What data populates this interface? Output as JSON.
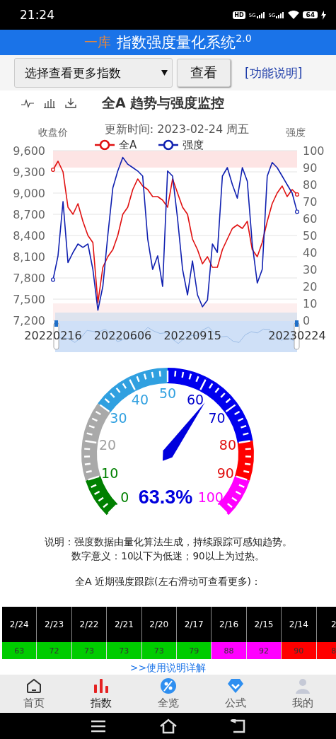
{
  "status_bar": {
    "time": "21:24",
    "hd_label": "HD",
    "networks": [
      "5G",
      "5G"
    ],
    "battery": "64"
  },
  "header": {
    "logo_text": "一库",
    "title": "指数强度量化系统$^{2.0}$"
  },
  "controls": {
    "select": "选择查看更多指数",
    "view_button": "查看",
    "help_link": "[功能说明]"
  },
  "chart_panel": {
    "title": "全A 趋势与强度监控",
    "chart_data": {
      "type": "line",
      "title": "更新时间: 2023-02-24 周五",
      "ylabel": "收盘价",
      "y2label": "强度",
      "categories": [
        "20220216",
        null,
        null,
        null,
        null,
        null,
        null,
        null,
        null,
        null,
        null,
        null,
        null,
        null,
        "20220606",
        null,
        null,
        null,
        null,
        null,
        null,
        null,
        null,
        null,
        null,
        null,
        null,
        null,
        "20220915",
        null,
        null,
        null,
        null,
        null,
        null,
        null,
        null,
        null,
        null,
        null,
        null,
        null,
        null,
        null,
        null,
        null,
        null,
        null,
        null,
        "20230224"
      ],
      "grid": true,
      "legend": "top",
      "ylim": [
        7200,
        9600
      ],
      "yticks": [
        {
          "value": 7200,
          "label": "7,200"
        },
        {
          "value": 7500,
          "label": "7,500"
        },
        {
          "value": 7800,
          "label": "7,800"
        },
        {
          "value": 8100,
          "label": "8,100"
        },
        {
          "value": 8400,
          "label": "8,400"
        },
        {
          "value": 8700,
          "label": "8,700"
        },
        {
          "value": 9000,
          "label": "9,000"
        },
        {
          "value": 9300,
          "label": "9,300"
        },
        {
          "value": 9600,
          "label": "9,600"
        }
      ],
      "y2lim": [
        0,
        100
      ],
      "y2ticks": [
        0,
        10,
        20,
        30,
        40,
        50,
        60,
        70,
        80,
        90,
        100
      ],
      "series": [
        {
          "name": "全A",
          "color": "#e01010",
          "values": [
            9330,
            9450,
            9300,
            8800,
            8700,
            8850,
            8600,
            8400,
            8300,
            7450,
            7950,
            8100,
            8200,
            8400,
            8700,
            8800,
            9050,
            9200,
            9100,
            9050,
            8950,
            8950,
            8900,
            8800,
            9200,
            9000,
            8800,
            8700,
            8350,
            8200,
            8000,
            8100,
            7950,
            7950,
            8200,
            8350,
            8500,
            8550,
            8500,
            8600,
            8200,
            8100,
            8300,
            8600,
            8850,
            9000,
            9100,
            8950,
            9050,
            8980
          ]
        },
        {
          "name": "强度",
          "color": "#1020b0",
          "axis": "y2",
          "values": [
            24,
            38,
            70,
            34,
            40,
            45,
            43,
            45,
            30,
            6,
            20,
            50,
            78,
            88,
            96,
            92,
            90,
            88,
            85,
            48,
            30,
            38,
            20,
            88,
            85,
            60,
            30,
            15,
            35,
            15,
            8,
            12,
            45,
            40,
            85,
            90,
            80,
            72,
            90,
            82,
            45,
            22,
            30,
            85,
            93,
            90,
            85,
            80,
            75,
            64
          ]
        }
      ]
    }
  },
  "gauge": {
    "reading": "63.3%",
    "labels": [
      {
        "text": "0",
        "color": "#008000"
      },
      {
        "text": "10",
        "color": "#008000"
      },
      {
        "text": "20",
        "color": "#a0a0a0"
      },
      {
        "text": "30",
        "color": "#30a0e0"
      },
      {
        "text": "40",
        "color": "#30a0e0"
      },
      {
        "text": "50",
        "color": "#30a0e0"
      },
      {
        "text": "60",
        "color": "#0000cc"
      },
      {
        "text": "70",
        "color": "#0000cc"
      },
      {
        "text": "80",
        "color": "#e01010"
      },
      {
        "text": "90",
        "color": "#e01010"
      },
      {
        "text": "100",
        "color": "#ff00ff"
      }
    ],
    "bands": [
      {
        "color": "#008000"
      },
      {
        "color": "#a9a9a9"
      },
      {
        "color": "#a9a9a9"
      },
      {
        "color": "#30a0e0"
      },
      {
        "color": "#30a0e0"
      },
      {
        "color": "#0000ee"
      },
      {
        "color": "#0000ee"
      },
      {
        "color": "#0000ee"
      },
      {
        "color": "#ff0000"
      },
      {
        "color": "#ff00ff"
      }
    ]
  },
  "notes": [
    "说明：强度数据由量化算法生成，持续跟踪可感知趋势。",
    "数字意义：10以下为低迷；90以上为过热。"
  ],
  "tracking_title": "全A 近期强度跟踪(左右滑动可查看更多)：",
  "tracking": [
    {
      "date": "2/24",
      "value": "63",
      "color": "#00cc00"
    },
    {
      "date": "2/23",
      "value": "72",
      "color": "#00cc00"
    },
    {
      "date": "2/22",
      "value": "73",
      "color": "#00cc00"
    },
    {
      "date": "2/21",
      "value": "73",
      "color": "#00cc00"
    },
    {
      "date": "2/20",
      "value": "73",
      "color": "#00cc00"
    },
    {
      "date": "2/17",
      "value": "79",
      "color": "#00cc00"
    },
    {
      "date": "2/16",
      "value": "88",
      "color": "#ff00ff"
    },
    {
      "date": "2/15",
      "value": "92",
      "color": "#ff00ff"
    },
    {
      "date": "2/14",
      "value": "90",
      "color": "#ff0000"
    },
    {
      "date": "2",
      "value": "8",
      "color": "#ff0000"
    }
  ],
  "guide_link": ">>使用说明详解",
  "bottom_nav": [
    {
      "label": "首页",
      "kind": "home",
      "selected": false
    },
    {
      "label": "指数",
      "kind": "index",
      "selected": true
    },
    {
      "label": "全览",
      "kind": "overview",
      "selected": false
    },
    {
      "label": "公式",
      "kind": "formula",
      "selected": false
    },
    {
      "label": "我的",
      "kind": "profile",
      "selected": false
    }
  ]
}
